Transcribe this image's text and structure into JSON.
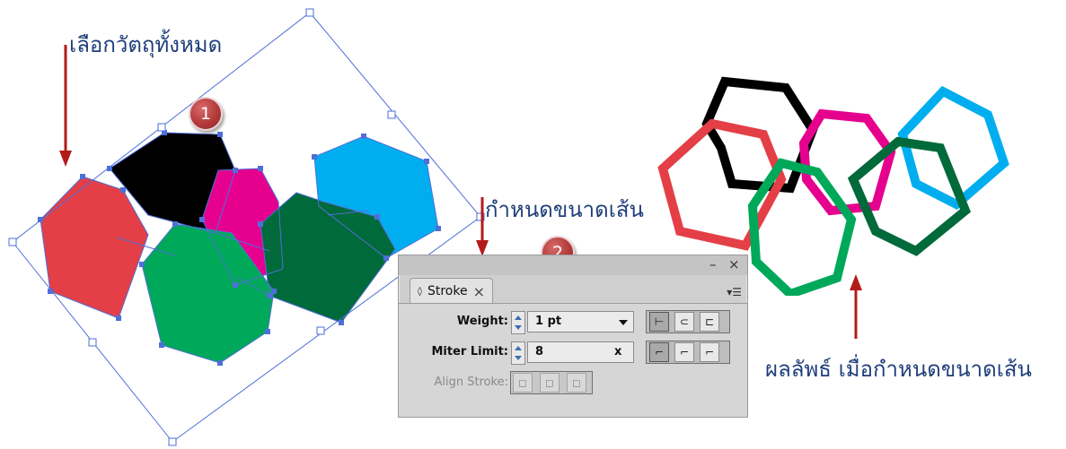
{
  "annotations": {
    "select_all": "เลือกวัตถุทั้งหมด",
    "set_stroke": "กำหนดขนาดเส้น",
    "result": "ผลลัพธ์ เมื่อกำหนดขนาดเส้น"
  },
  "badges": [
    "1",
    "2"
  ],
  "colors": {
    "red": "#e43f46",
    "black": "#000000",
    "magenta": "#e5008e",
    "cyan": "#00aeef",
    "green": "#00a85a",
    "dark_green": "#006a3a",
    "selection": "#4f6fd8",
    "arrow": "#b31b1b",
    "annotation_text": "#1f3f7a"
  },
  "stroke_panel": {
    "tab_label": "Stroke",
    "tab_icon": "diamond-arrows-icon",
    "close_glyph": "×",
    "minimize_glyph": "–",
    "panel_close_glyph": "×",
    "menu_icon": "panel-menu-icon",
    "weight_label": "Weight:",
    "weight_value": "1 pt",
    "miter_label": "Miter Limit:",
    "miter_value": "8",
    "miter_unit": "x",
    "align_label": "Align Stroke:",
    "cap_icons": [
      "butt-cap-icon",
      "round-cap-icon",
      "projecting-cap-icon"
    ],
    "join_icons": [
      "miter-join-icon",
      "round-join-icon",
      "bevel-join-icon"
    ],
    "align_icons": [
      "align-center-icon",
      "align-inside-icon",
      "align-outside-icon"
    ]
  }
}
